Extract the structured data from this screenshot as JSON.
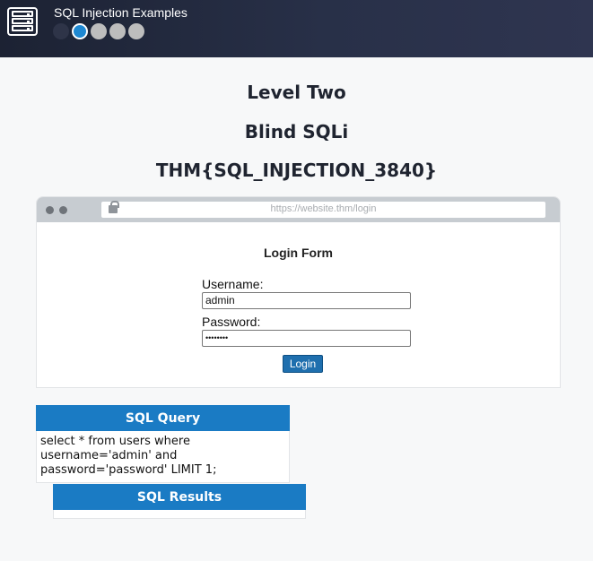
{
  "header": {
    "title": "SQL Injection Examples",
    "app_icon": "server-rack-icon",
    "progress": {
      "total": 5,
      "current_index": 1
    }
  },
  "page": {
    "level": "Level Two",
    "subtitle": "Blind SQLi",
    "flag": "THM{SQL_INJECTION_3840}"
  },
  "browser": {
    "url": "https://website.thm/login"
  },
  "login_form": {
    "title": "Login Form",
    "username_label": "Username:",
    "username_value": "admin",
    "password_label": "Password:",
    "password_value": "••••••••",
    "login_label": "Login"
  },
  "sql_query": {
    "title": "SQL Query",
    "lines": [
      "select * from users where",
      "username='admin' and",
      "password='password' LIMIT 1;"
    ]
  },
  "sql_results": {
    "title": "SQL Results"
  },
  "colors": {
    "accent": "#1a7bc4",
    "header_bg": "#283048",
    "current_step": "#1e88d2"
  }
}
